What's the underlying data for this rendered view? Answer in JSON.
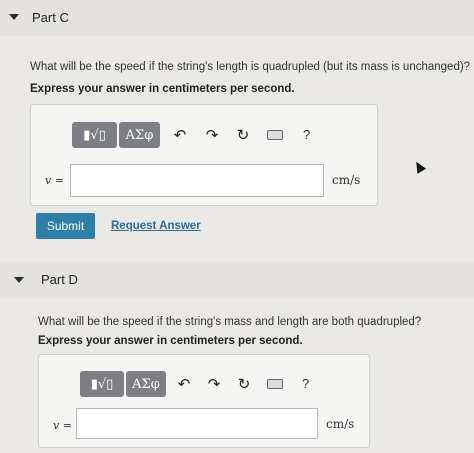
{
  "part_c": {
    "title": "Part C",
    "question": "What will be the speed if the string's length is quadrupled (but its mass is unchanged)?",
    "instruction": "Express your answer in centimeters per second.",
    "toolbar": {
      "template_label": "▮√▯",
      "greek_label": "ΑΣφ",
      "help_label": "?"
    },
    "variable_label": "v =",
    "input_value": "",
    "unit": "cm/s",
    "submit_label": "Submit",
    "request_label": "Request Answer"
  },
  "part_d": {
    "title": "Part D",
    "question": "What will be the speed if the string's mass and length are both quadrupled?",
    "instruction": "Express your answer in centimeters per second.",
    "toolbar": {
      "template_label": "▮√▯",
      "greek_label": "ΑΣφ",
      "help_label": "?"
    },
    "variable_label": "v =",
    "input_value": "",
    "unit": "cm/s"
  },
  "colors": {
    "submit_bg": "#2e7fa8",
    "link": "#2a6f9e",
    "toolbar_button": "#7d7f84"
  }
}
